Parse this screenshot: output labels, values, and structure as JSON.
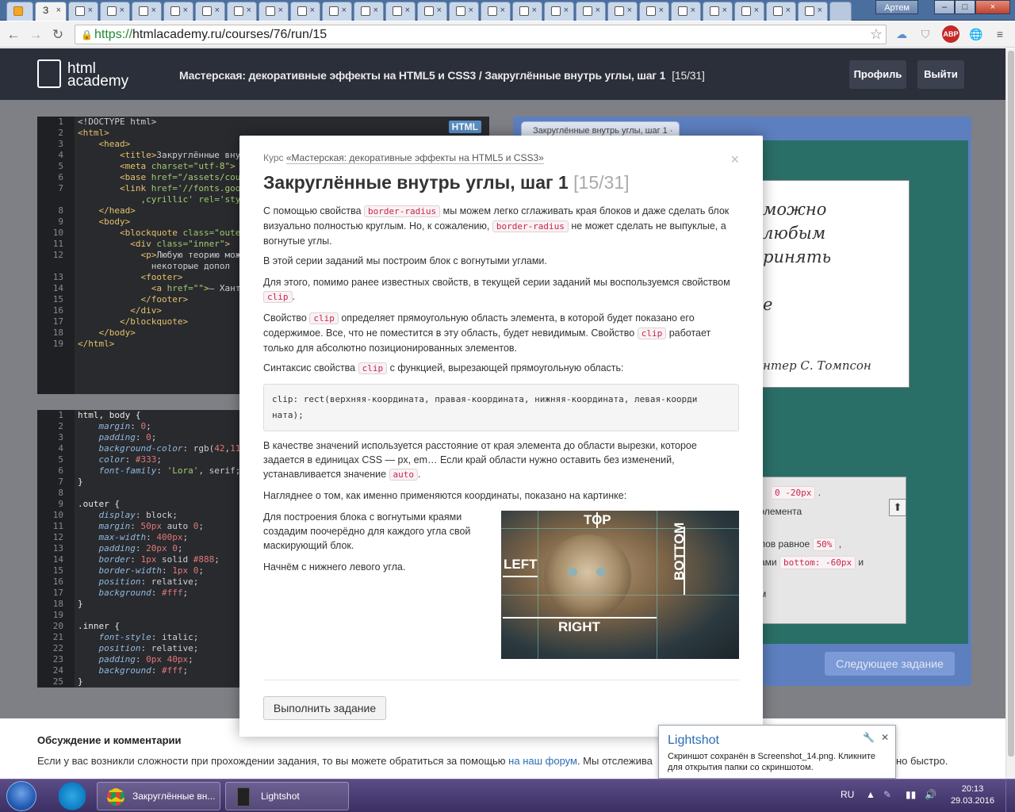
{
  "browser": {
    "active_tab_title": "З",
    "user": "Артем",
    "url_proto": "https://",
    "url_rest": "htmlacademy.ru/courses/76/run/15"
  },
  "header": {
    "logo_line1": "html",
    "logo_line2": "academy",
    "course_title": "Мастерская: декоративные эффекты на HTML5 и CSS3 / Закруглённые внутрь углы, шаг 1",
    "progress": "[15/31]",
    "profile_label": "Профиль",
    "logout_label": "Выйти"
  },
  "html_editor": {
    "badge": "HTML",
    "line_numbers": [
      "1",
      "2",
      "3",
      "4",
      "5",
      "6",
      "7",
      "",
      "8",
      "9",
      "10",
      "11",
      "12",
      "",
      "13",
      "14",
      "15",
      "16",
      "17",
      "18",
      "19"
    ]
  },
  "css_editor": {
    "line_numbers": [
      "1",
      "2",
      "3",
      "4",
      "5",
      "6",
      "7",
      "8",
      "9",
      "10",
      "11",
      "12",
      "13",
      "14",
      "15",
      "16",
      "17",
      "18",
      "19",
      "20",
      "21",
      "22",
      "23",
      "24",
      "25"
    ]
  },
  "preview": {
    "tab_label": "Закруглённые внутрь углы, шаг 1 ·",
    "quote_lines": [
      "можно",
      "любым",
      "ринять",
      "е"
    ],
    "quote_author": "нтер С. Томпсон",
    "lower_fragments": {
      "chip1": "0 -20px",
      "text1": "элемента",
      "text2": "лов равное",
      "chip2": "50%",
      "text3": "ами",
      "chip3": "bottom: -60px",
      "text4": "и",
      "text5": "м"
    },
    "next_button": "Следующее задание"
  },
  "modal": {
    "crumb_prefix": "Курс",
    "crumb_link": "«Мастерская: декоративные эффекты на HTML5 и CSS3»",
    "title": "Закруглённые внутрь углы, шаг 1",
    "title_count": "[15/31]",
    "p1_a": "С помощью свойства",
    "p1_chip1": "border-radius",
    "p1_b": "мы можем легко сглаживать края блоков и даже сделать блок визуально полностью круглым. Но, к сожалению,",
    "p1_chip2": "border-radius",
    "p1_c": "не может сделать не выпуклые, а вогнутые углы.",
    "p2": "В этой серии заданий мы построим блок с вогнутыми углами.",
    "p3_a": "Для этого, помимо ранее известных свойств, в текущей серии заданий мы воспользуемся свойством",
    "p3_chip": "clip",
    "p3_b": ".",
    "p4_a": "Свойство",
    "p4_chip1": "clip",
    "p4_b": "определяет прямоугольную область элемента, в которой будет показано его содержимое. Все, что не поместится в эту область, будет невидимым. Свойство",
    "p4_chip2": "clip",
    "p4_c": "работает только для абсолютно позиционированных элементов.",
    "p5_a": "Синтаксис свойства",
    "p5_chip": "clip",
    "p5_b": "с функцией, вырезающей прямоугольную область:",
    "code": "clip: rect(верхняя-координата, правая-координата, нижняя-координата, левая-коорди\nната);",
    "p6_a": "В качестве значений используется расстояние от края элемента до области вырезки, которое задается в единицах CSS — px, em… Если край области нужно оставить без изменений, устанавливается значение",
    "p6_chip": "auto",
    "p6_b": ".",
    "p7": "Нагляднее о том, как именно применяются координаты, показано на картинке:",
    "p8": "Для построения блока с вогнутыми краями создадим поочерёдно для каждого угла свой маскирующий блок.",
    "p9": "Начнём с нижнего левого угла.",
    "img_labels": {
      "top": "TOP",
      "left": "LEFT",
      "right": "RIGHT",
      "bottom": "BOTTOM"
    },
    "run_button": "Выполнить задание"
  },
  "discussion": {
    "heading": "Обсуждение и комментарии",
    "text_a": "Если у вас возникли сложности при прохождении задания, то вы можете обратиться за помощью",
    "link": "на наш форум",
    "text_b": ". Мы отслежива",
    "text_c": "но быстро."
  },
  "toast": {
    "title": "Lightshot",
    "body": "Скриншот сохранён в Screenshot_14.png. Кликните для открытия папки со скриншотом."
  },
  "taskbar": {
    "item1": "Закруглённые вн...",
    "item2": "Lightshot",
    "lang": "RU",
    "time": "20:13",
    "date": "29.03.2016"
  }
}
